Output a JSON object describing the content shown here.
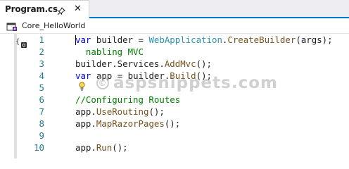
{
  "tab": {
    "title": "Program.cs",
    "pin_icon": "pin-icon",
    "close_icon": "close-icon",
    "close_glyph": "✕"
  },
  "navbar": {
    "project_name": "Core_HelloWorld",
    "project_icon": "csharp-project-icon"
  },
  "gutter": {
    "scope_glyph": "{",
    "scope_icon": "scope-icon"
  },
  "colors": {
    "keyword": "#0000ff",
    "type": "#2b91af",
    "method": "#74531f",
    "comment": "#008000",
    "line_number": "#237893",
    "accent": "#007acc"
  },
  "lines": [
    {
      "number": "1",
      "tokens": [
        [
          "kw",
          "var"
        ],
        [
          "",
          "builder = "
        ],
        [
          "ty",
          "WebApplication"
        ],
        [
          "",
          "."
        ],
        [
          "fn",
          "CreateBuilder"
        ],
        [
          "",
          "(args);"
        ]
      ]
    },
    {
      "number": "2",
      "tokens": [
        [
          "",
          "  "
        ],
        [
          "cm",
          "nabling MVC"
        ]
      ]
    },
    {
      "number": "3",
      "tokens": [
        [
          "",
          "builder.Services."
        ],
        [
          "fn",
          "AddMvc"
        ],
        [
          "",
          "();"
        ]
      ]
    },
    {
      "number": "4",
      "tokens": [
        [
          "kw",
          "var"
        ],
        [
          "",
          "app = builder."
        ],
        [
          "fn",
          "Build"
        ],
        [
          "",
          "();"
        ]
      ]
    },
    {
      "number": "5",
      "tokens": []
    },
    {
      "number": "6",
      "tokens": [
        [
          "cm",
          "//Configuring Routes"
        ]
      ]
    },
    {
      "number": "7",
      "tokens": [
        [
          "",
          "app."
        ],
        [
          "fn",
          "UseRouting"
        ],
        [
          "",
          "();"
        ]
      ]
    },
    {
      "number": "8",
      "tokens": [
        [
          "",
          "app."
        ],
        [
          "fn",
          "MapRazorPages"
        ],
        [
          "",
          "();"
        ]
      ]
    },
    {
      "number": "9",
      "tokens": []
    },
    {
      "number": "10",
      "tokens": [
        [
          "",
          "app."
        ],
        [
          "fn",
          "Run"
        ],
        [
          "",
          "();"
        ]
      ]
    }
  ],
  "hint_icon": "lightbulb-icon",
  "watermark": {
    "symbol": "©",
    "text": "aspsnippets.com"
  }
}
